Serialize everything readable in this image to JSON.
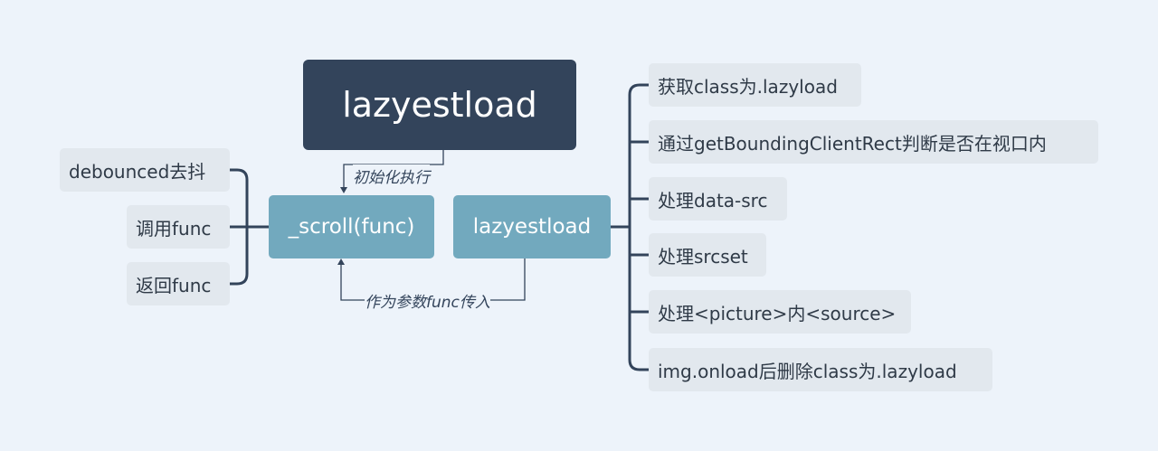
{
  "root": {
    "label": "lazyestload"
  },
  "scroll_node": {
    "label": "_scroll(func)"
  },
  "lazy_node": {
    "label": "lazyestload"
  },
  "edge_labels": {
    "init": "初始化执行",
    "param": "作为参数func传入"
  },
  "left_leaves": [
    "debounced去抖",
    "调用func",
    "返回func"
  ],
  "right_leaves": [
    "获取class为.lazyload",
    "通过getBoundingClientRect判断是否在视口内",
    "处理data-src",
    "处理srcset",
    "处理<picture>内<source>",
    "img.onload后删除class为.lazyload"
  ],
  "colors": {
    "background": "#edf3fa",
    "root_fill": "#33445b",
    "main_fill": "#72a9be",
    "leaf_fill": "#e2e8ee",
    "line": "#33445b"
  }
}
